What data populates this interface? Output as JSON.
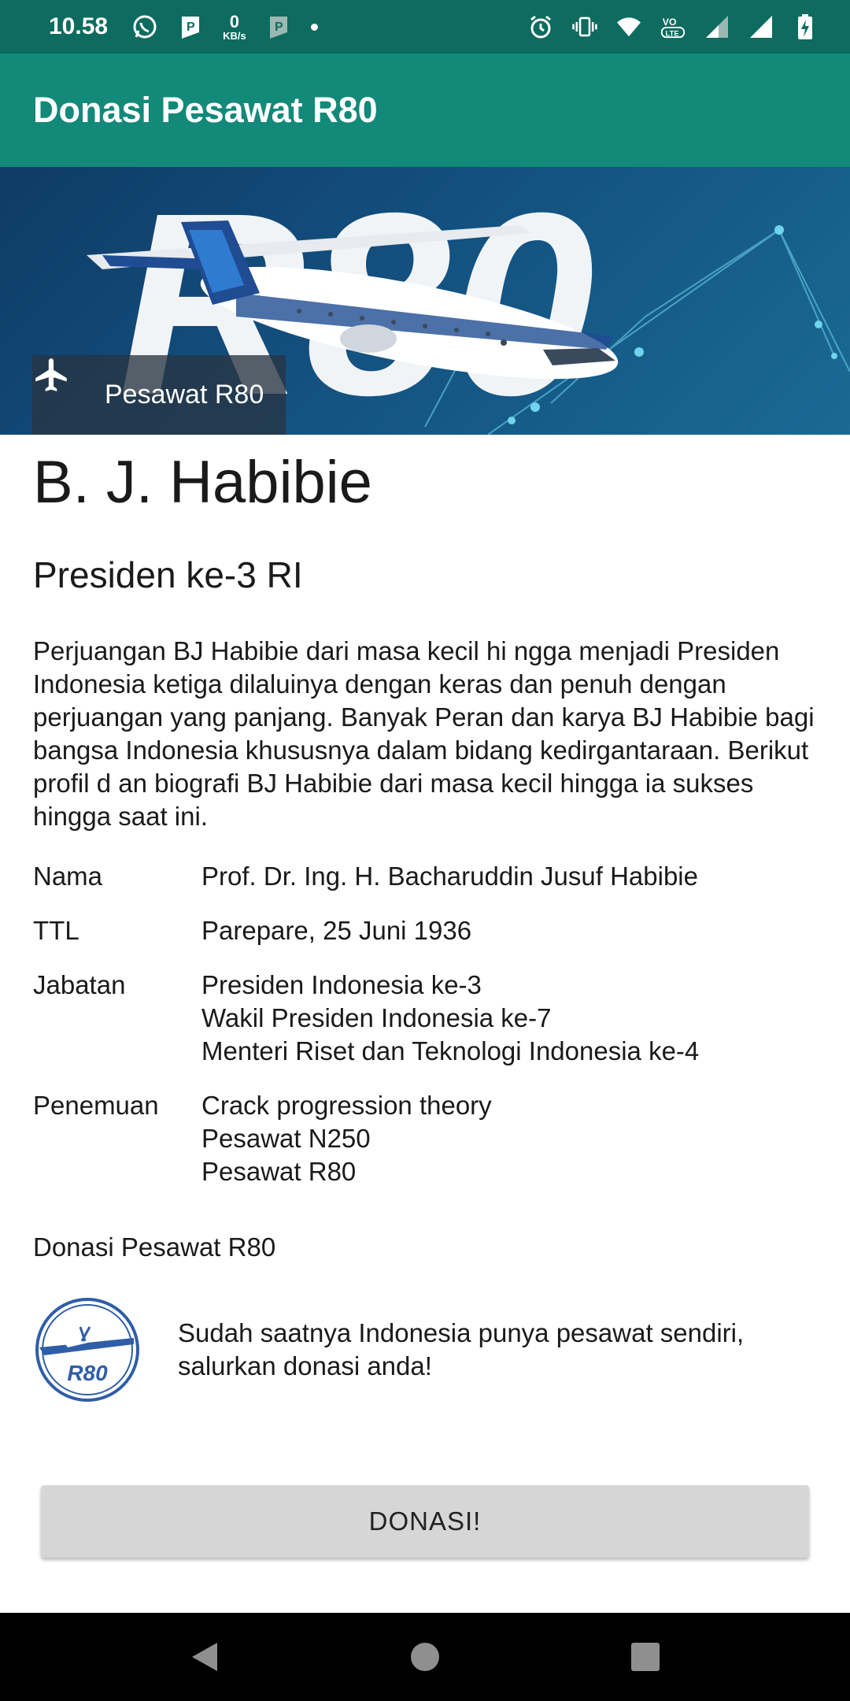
{
  "status_bar": {
    "time": "10.58",
    "network_speed_value": "0",
    "network_speed_unit": "KB/s",
    "icons": [
      "whatsapp-icon",
      "p-notification-icon",
      "p-notification-icon",
      "dot-icon",
      "alarm-icon",
      "vibrate-icon",
      "wifi-icon",
      "volte-icon",
      "signal-icon",
      "signal-icon",
      "battery-charging-icon"
    ]
  },
  "app_bar": {
    "title": "Donasi Pesawat R80"
  },
  "hero": {
    "caption": "Pesawat R80",
    "icon": "airplane-icon"
  },
  "profile": {
    "name": "B. J. Habibie",
    "subtitle": "Presiden ke-3 RI",
    "bio": "Perjuangan BJ Habibie dari masa kecil hi ngga menjadi Presiden Indonesia ketiga dilaluinya dengan keras dan penuh dengan perjuangan yang panjang. Banyak Peran dan karya BJ Habibie bagi bangsa Indonesia khususnya dalam bidang kedirgantaraan. Berikut profil d an biografi BJ Habibie dari masa kecil hingga ia sukses hingga saat ini.",
    "details": [
      {
        "label": "Nama",
        "value": "Prof. Dr. Ing. H. Bacharuddin Jusuf Habibie"
      },
      {
        "label": "TTL",
        "value": "Parepare, 25 Juni 1936"
      },
      {
        "label": "Jabatan",
        "value": "Presiden Indonesia ke-3\n Wakil Presiden Indonesia ke-7\n Menteri Riset dan Teknologi Indonesia ke-4"
      },
      {
        "label": "Penemuan",
        "value": "Crack progression theory\n Pesawat N250\n Pesawat R80"
      }
    ]
  },
  "donation": {
    "heading": "Donasi Pesawat R80",
    "logo_text": "R80",
    "message": "Sudah saatnya Indonesia punya pesawat sendiri, salurkan donasi anda!",
    "button_label": "DONASI!"
  },
  "nav_bar": {
    "buttons": [
      "back-icon",
      "home-icon",
      "recents-icon"
    ]
  },
  "colors": {
    "status_bar": "#0d6b5f",
    "app_bar": "#13897a",
    "button": "#d6d6d6"
  }
}
